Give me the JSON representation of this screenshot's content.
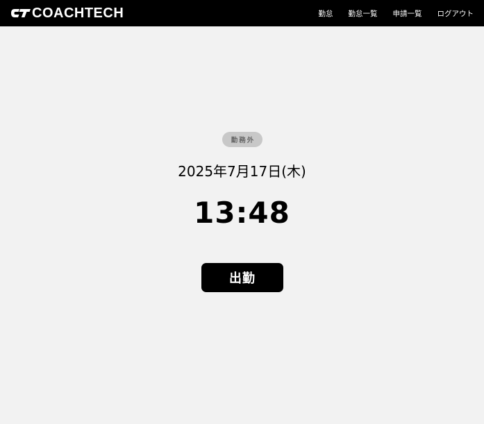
{
  "header": {
    "logo_text": "COACHTECH",
    "nav": [
      {
        "label": "勤怠"
      },
      {
        "label": "勤怠一覧"
      },
      {
        "label": "申請一覧"
      },
      {
        "label": "ログアウト"
      }
    ]
  },
  "main": {
    "status": "勤務外",
    "date": "2025年7月17日(木)",
    "time": "13:48",
    "clock_in_label": "出勤"
  },
  "colors": {
    "header_bg": "#000000",
    "page_bg": "#f2f2f2",
    "badge_bg": "#c8c8c8",
    "button_bg": "#000000"
  }
}
